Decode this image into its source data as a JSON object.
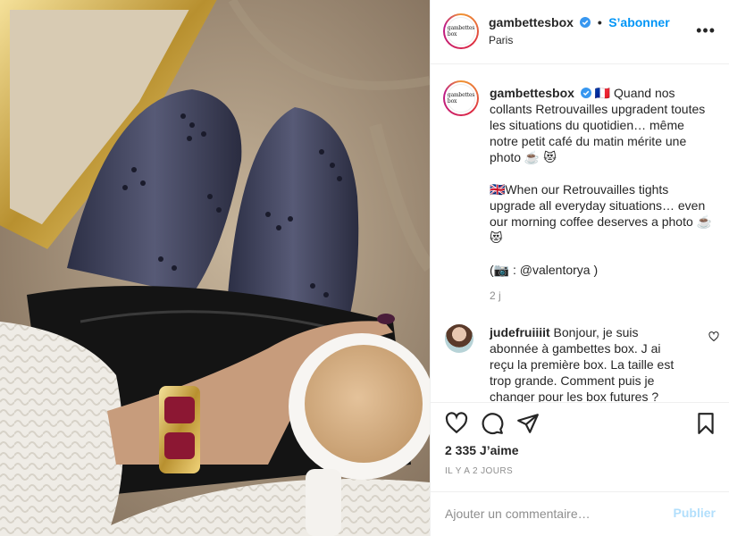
{
  "post": {
    "username": "gambettesbox",
    "follow_label": "S’abonner",
    "location": "Paris",
    "avatar_text": "gambettes box",
    "more_label": "•••",
    "caption": {
      "line1": "🇫🇷 Quand nos collants Retrouvailles upgradent toutes les situations du quotidien… même notre petit café du matin mérite une photo ☕️ 😻",
      "line2": "🇬🇧When our Retrouvailles tights upgrade all everyday situations… even our morning coffee deserves a photo ☕️ 😻",
      "line3": "(📷 : @valentorya )"
    },
    "caption_time": "2 j",
    "comment": {
      "username": "judefruiiiit",
      "text": " Bonjour, je suis abonnée à gambettes box. J ai reçu la première box. La taille est trop grande. Comment puis je changer pour les box futures ?"
    },
    "likes": "2 335 J’aime",
    "date": "IL Y A 2 JOURS",
    "comment_placeholder": "Ajouter un commentaire…",
    "publish_label": "Publier"
  },
  "icons": {
    "like": "heart-icon",
    "comment": "comment-icon",
    "share": "share-icon",
    "save": "bookmark-icon",
    "verified": "verified-badge-icon"
  },
  "colors": {
    "accent": "#0095f6",
    "publish_disabled": "#b2dffc",
    "muted": "#8e8e8e"
  }
}
